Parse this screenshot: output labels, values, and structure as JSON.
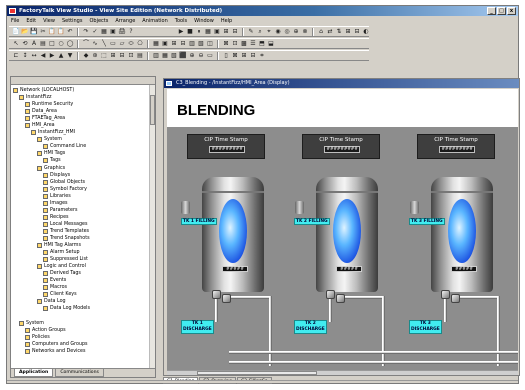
{
  "window": {
    "title": "FactoryTalk View Studio - View Site Edition (Network Distributed)",
    "controls": [
      "_",
      "□",
      "x"
    ]
  },
  "menu": [
    "File",
    "Edit",
    "View",
    "Settings",
    "Objects",
    "Arrange",
    "Animation",
    "Tools",
    "Window",
    "Help"
  ],
  "toolbar": {
    "row1": [
      "📄",
      "📂",
      "💾",
      "✂",
      "📋",
      "📋",
      "↶",
      "↷",
      "✓",
      "▦",
      "▣",
      "🖨",
      "?"
    ],
    "row1_right": [
      "▶",
      "■",
      "⏸",
      "▦",
      "▣",
      "⊞",
      "⊟",
      "✎",
      "⌕",
      "⌖",
      "◉",
      "◎",
      "⊕",
      "⊗",
      "⌂",
      "⇄",
      "⇅",
      "⊞",
      "⊟",
      "◐"
    ],
    "row2": [
      "↖",
      "⟲",
      "A",
      "▤",
      "□",
      "○",
      "◯",
      "⌒",
      "∿",
      "╲",
      "▭",
      "▱",
      "⬭",
      "⎔",
      "▦",
      "▣",
      "⊞",
      "⊟",
      "▥",
      "▧",
      "◫",
      "⊠",
      "⊡",
      "▩",
      "☰",
      "⬒",
      "⬓"
    ],
    "row3": [
      "⊏",
      "↕",
      "↔",
      "◀",
      "▶",
      "▲",
      "▼",
      "◆",
      "⊛",
      "⬚",
      "⊞",
      "⊟",
      "⊡",
      "▤",
      "▥",
      "▦",
      "▧",
      "⬛",
      "⊕",
      "⊖",
      "▭",
      "▯",
      "⊠",
      "⊞",
      "⊟",
      "⌗"
    ]
  },
  "explorer": {
    "tree": [
      {
        "label": "Network (LOCALHOST)",
        "indent": 0
      },
      {
        "label": "InstantFizz",
        "indent": 1
      },
      {
        "label": "Runtime Security",
        "indent": 2
      },
      {
        "label": "Data_Area",
        "indent": 2
      },
      {
        "label": "FTAETag_Area",
        "indent": 2
      },
      {
        "label": "HMI_Area",
        "indent": 2
      },
      {
        "label": "InstantFizz_HMI",
        "indent": 3
      },
      {
        "label": "System",
        "indent": 4
      },
      {
        "label": "Command Line",
        "indent": 5
      },
      {
        "label": "HMI Tags",
        "indent": 4
      },
      {
        "label": "Tags",
        "indent": 5
      },
      {
        "label": "Graphics",
        "indent": 4
      },
      {
        "label": "Displays",
        "indent": 5
      },
      {
        "label": "Global Objects",
        "indent": 5
      },
      {
        "label": "Symbol Factory",
        "indent": 5
      },
      {
        "label": "Libraries",
        "indent": 5
      },
      {
        "label": "Images",
        "indent": 5
      },
      {
        "label": "Parameters",
        "indent": 5
      },
      {
        "label": "Recipes",
        "indent": 5
      },
      {
        "label": "Local Messages",
        "indent": 5
      },
      {
        "label": "Trend Templates",
        "indent": 5
      },
      {
        "label": "Trend Snapshots",
        "indent": 5
      },
      {
        "label": "HMI Tag Alarms",
        "indent": 4
      },
      {
        "label": "Alarm Setup",
        "indent": 5
      },
      {
        "label": "Suppressed List",
        "indent": 5
      },
      {
        "label": "Logic and Control",
        "indent": 4
      },
      {
        "label": "Derived Tags",
        "indent": 5
      },
      {
        "label": "Events",
        "indent": 5
      },
      {
        "label": "Macros",
        "indent": 5
      },
      {
        "label": "Client Keys",
        "indent": 5
      },
      {
        "label": "Data Log",
        "indent": 4
      },
      {
        "label": "Data Log Models",
        "indent": 5
      },
      {
        "label": "",
        "indent": 0
      },
      {
        "label": "System",
        "indent": 1
      },
      {
        "label": "Action Groups",
        "indent": 2
      },
      {
        "label": "Policies",
        "indent": 2
      },
      {
        "label": "Computers and Groups",
        "indent": 2
      },
      {
        "label": "Networks and Devices",
        "indent": 2
      }
    ],
    "tabs": [
      {
        "label": "Application"
      },
      {
        "label": "Communications"
      }
    ]
  },
  "display": {
    "title": "C3_Blending - /InstantFizz/HMI_Area (Display)",
    "heading": "BLENDING",
    "stamp_label": "CIP Time Stamp",
    "stamp_value": "#########",
    "tanks": [
      {
        "fill_label": "TK 1 FILLING",
        "level_value": "#####",
        "discharge_line1": "TK 1",
        "discharge_line2": "DISCHARGE"
      },
      {
        "fill_label": "TK 2 FILLING",
        "level_value": "#####",
        "discharge_line1": "TK 2",
        "discharge_line2": "DISCHARGE"
      },
      {
        "fill_label": "TK 3 FILLING",
        "level_value": "#####",
        "discharge_line1": "TK 3",
        "discharge_line2": "DISCHARGE"
      }
    ]
  },
  "bottom_tabs": [
    "C1_Blending",
    "C2_Overview",
    "C3_FillingCo"
  ],
  "colors": {
    "accent_label": "#41ecf0",
    "liquid": "#1a4fe0",
    "titlebar": "#0a246a"
  }
}
